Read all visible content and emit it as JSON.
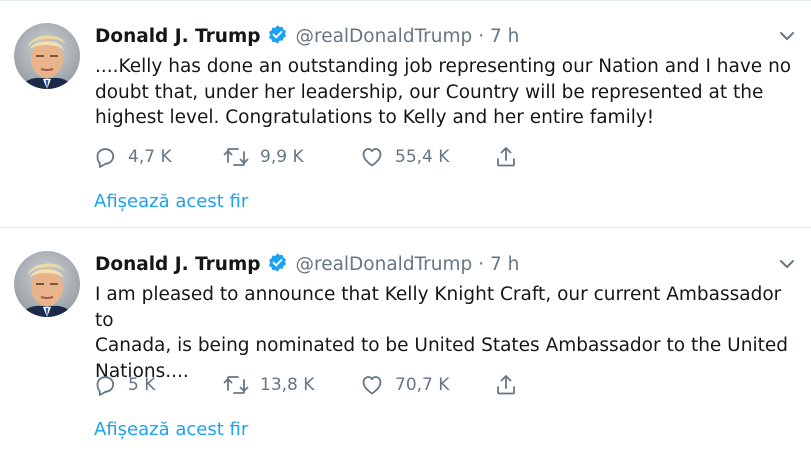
{
  "colors": {
    "text": "#14171a",
    "meta": "#657786",
    "link": "#1da1f2",
    "verified": "#1da1f2",
    "divider": "#e6ecf0"
  },
  "icons": {
    "verified": "verified-badge-icon",
    "reply": "reply-icon",
    "retweet": "retweet-icon",
    "like": "like-heart-icon",
    "share": "share-icon",
    "more": "chevron-down-icon"
  },
  "tweets": [
    {
      "author": {
        "name": "Donald J. Trump",
        "handle": "@realDonaldTrump",
        "time": "· 7 h"
      },
      "lines": [
        "....Kelly has done an outstanding job representing our Nation and I have no",
        "doubt that, under her leadership, our Country will be represented at the",
        "highest level. Congratulations to Kelly and her entire family!"
      ],
      "stats": {
        "replies": "4,7 K",
        "retweets": "9,9 K",
        "likes": "55,4 K"
      },
      "thread_link": "Afișează acest fir"
    },
    {
      "author": {
        "name": "Donald J. Trump",
        "handle": "@realDonaldTrump",
        "time": "· 7 h"
      },
      "lines": [
        "I am pleased to announce that Kelly Knight Craft, our current Ambassador to",
        "Canada, is being nominated to be United States Ambassador to the United",
        "Nations...."
      ],
      "stats": {
        "replies": "5 K",
        "retweets": "13,8 K",
        "likes": "70,7 K"
      },
      "thread_link": "Afișează acest fir"
    }
  ]
}
